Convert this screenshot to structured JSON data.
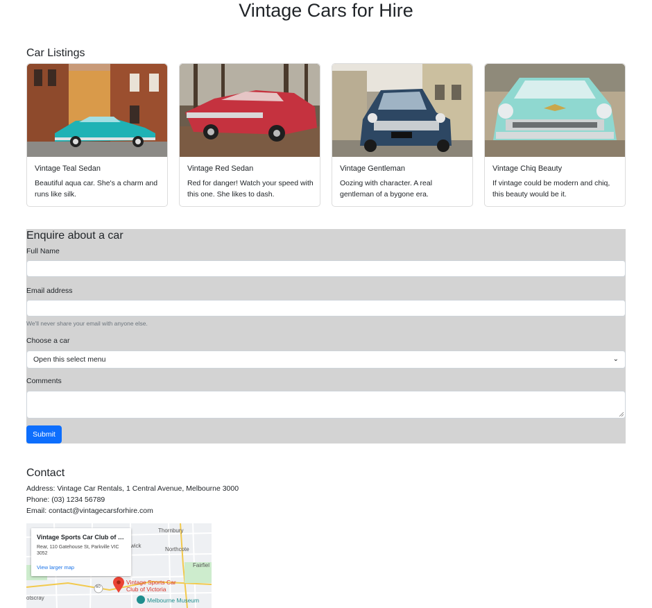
{
  "page": {
    "title": "Vintage Cars for Hire"
  },
  "listings": {
    "heading": "Car Listings",
    "cars": [
      {
        "title": "Vintage Teal Sedan",
        "text": "Beautiful aqua car. She's a charm and runs like silk."
      },
      {
        "title": "Vintage Red Sedan",
        "text": "Red for danger! Watch your speed with this one. She likes to dash."
      },
      {
        "title": "Vintage Gentleman",
        "text": "Oozing with character. A real gentleman of a bygone era."
      },
      {
        "title": "Vintage Chiq Beauty",
        "text": "If vintage could be modern and chiq, this beauty would be it."
      }
    ]
  },
  "form": {
    "title": "Enquire about a car",
    "name_label": "Full Name",
    "email_label": "Email address",
    "email_help": "We'll never share your email with anyone else.",
    "car_label": "Choose a car",
    "car_select": "Open this select menu",
    "comments_label": "Comments",
    "submit": "Submit"
  },
  "contact": {
    "heading": "Contact",
    "address": "Address: Vintage Car Rentals, 1 Central Avenue, Melbourne 3000",
    "phone": "Phone: (03) 1234 56789",
    "email": "Email: contact@vintagecarsforhire.com"
  },
  "map": {
    "card_title": "Vintage Sports Car Club of Vi...",
    "card_address": "Rear, 110 Gatehouse St, Parkville VIC 3052",
    "card_link": "View larger map",
    "place_name": "Vintage Sports Car Club of Victoria",
    "museum": "Melbourne Museum",
    "labels": [
      "Thornbury",
      "Northcote",
      "Fairfiel",
      "otscray",
      "wick",
      "60"
    ]
  },
  "colors": {
    "primary": "#0d6efd",
    "form_bg": "#d3d3d3",
    "pin": "#ea4335"
  }
}
